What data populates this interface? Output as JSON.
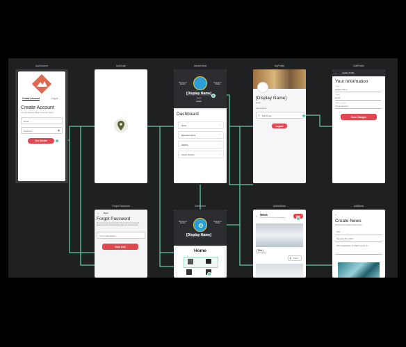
{
  "labels": {
    "auth_screen": "AuthScreen",
    "auth_gate": "AuthGate",
    "admin_home": "AdminHome",
    "my_profile": "MyProfile",
    "edit_profile": "EditProfile",
    "forgot_password": "Forgot Password",
    "user_home": "UserHome",
    "admin_news": "AdminNews",
    "add_news": "AddNews"
  },
  "auth": {
    "tab_create": "Create Account",
    "tab_login": "Log In",
    "title": "Create Account",
    "subtitle": "Let's get started by filling out the form below.",
    "email_placeholder": "Email",
    "password_placeholder": "Password",
    "button": "Get Started"
  },
  "admin_home": {
    "left_link": "Business & Industry",
    "right_link": "Example & Details",
    "display_name": "[Display Name]",
    "email": "Email",
    "admin_badge": "ADMIN",
    "dashboard_title": "Dashboard",
    "rows": [
      "News",
      "Barcodes Genre",
      "NEWTo",
      "Useful Number"
    ]
  },
  "my_profile": {
    "display_name": "[Display Name]",
    "email": "Email",
    "section": "Your Account",
    "edit_row": "Edit Profile",
    "logout": "Logout"
  },
  "edit_profile": {
    "header": "Update Profile",
    "title": "Your Information",
    "name_label": "Name",
    "name_value": "Display Name",
    "email_label": "Email",
    "email_value": "Email",
    "phone_label": "Phone Number",
    "phone_value": "Phone Number",
    "button": "Save Changes"
  },
  "forgot": {
    "back": "Back",
    "title": "Forgot Password",
    "desc": "We will send you an email with a link to reset your password, please enter the email associated with your account below.",
    "field": "Your email address...",
    "button": "Send Link"
  },
  "user_home": {
    "left_link": "Business & Industry",
    "right_link": "Example & Details",
    "display_name": "[Display Name]",
    "title": "Home"
  },
  "admin_news": {
    "title": "News",
    "subtitle": "Browse the latest news & get updates.",
    "add_button": "Add",
    "card_title": "[Title]",
    "card_meta": "[description]",
    "delete_label": "Delete"
  },
  "add_news": {
    "title": "Create News",
    "subtitle": "Fill out the form below to submit news.",
    "field_title": "Title",
    "field_date": "Saturday 6th, 2023",
    "field_desc": "Short description of what is going on..."
  }
}
